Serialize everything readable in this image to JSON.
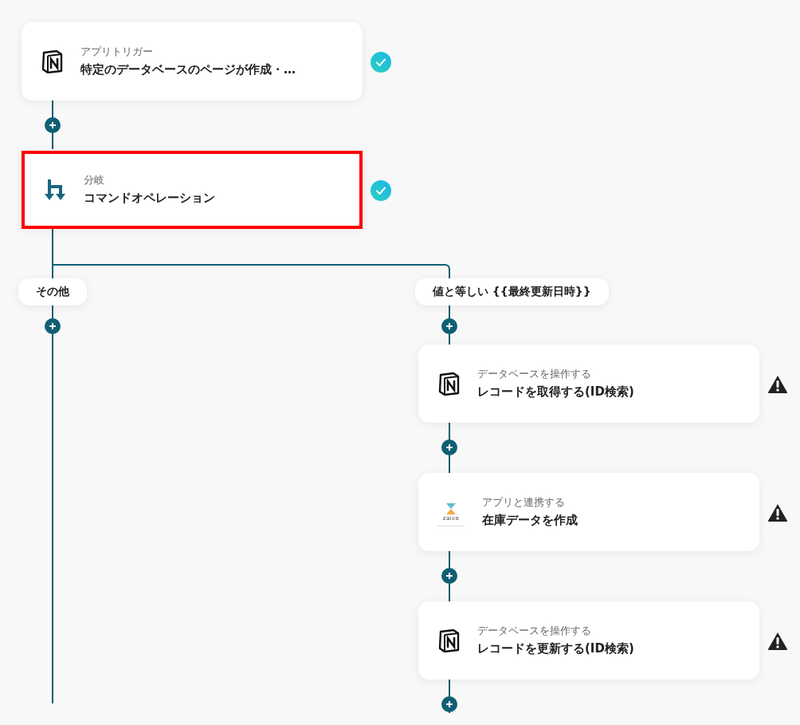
{
  "main_steps": [
    {
      "kind": "notion",
      "category": "アプリトリガー",
      "title": "特定のデータベースのページが作成・…",
      "complete": true,
      "highlighted": false
    },
    {
      "kind": "branch",
      "category": "分岐",
      "title": "コマンドオペレーション",
      "complete": true,
      "highlighted": true
    }
  ],
  "branches": [
    {
      "label": "その他"
    },
    {
      "label": "値と等しい {{最終更新日時}}",
      "steps": [
        {
          "kind": "notion",
          "category": "データベースを操作する",
          "title": "レコードを取得する(ID検索)",
          "complete": false,
          "highlighted": false
        },
        {
          "kind": "zaico",
          "logo_text": "zaico",
          "category": "アプリと連携する",
          "title": "在庫データを作成",
          "complete": false,
          "highlighted": false
        },
        {
          "kind": "notion",
          "category": "データベースを操作する",
          "title": "レコードを更新する(ID検索)",
          "complete": false,
          "highlighted": false
        }
      ]
    }
  ]
}
